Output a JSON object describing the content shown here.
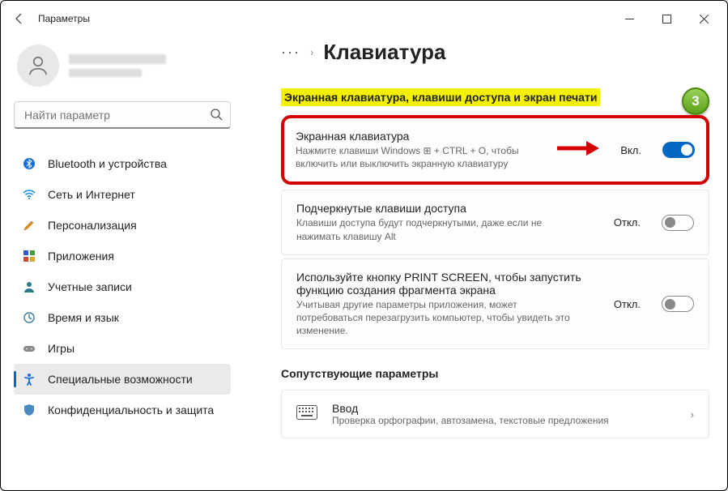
{
  "window": {
    "title": "Параметры"
  },
  "search": {
    "placeholder": "Найти параметр"
  },
  "sidebar_items": [
    {
      "label": "Bluetooth и устройства"
    },
    {
      "label": "Сеть и Интернет"
    },
    {
      "label": "Персонализация"
    },
    {
      "label": "Приложения"
    },
    {
      "label": "Учетные записи"
    },
    {
      "label": "Время и язык"
    },
    {
      "label": "Игры"
    },
    {
      "label": "Специальные возможности"
    },
    {
      "label": "Конфиденциальность и защита"
    }
  ],
  "breadcrumb": {
    "dots": "···",
    "sep": "›",
    "page": "Клавиатура"
  },
  "section_title": "Экранная клавиатура, клавиши доступа и экран печати",
  "badge": "3",
  "cards": [
    {
      "title": "Экранная клавиатура",
      "desc": "Нажмите клавиши Windows ⊞ + CTRL + O, чтобы включить или выключить экранную клавиатуру",
      "state_label": "Вкл.",
      "on": true
    },
    {
      "title": "Подчеркнутые клавиши доступа",
      "desc": "Клавиши доступа будут подчеркнутыми, даже если не нажимать клавишу Alt",
      "state_label": "Откл.",
      "on": false
    },
    {
      "title": "Используйте кнопку PRINT SCREEN, чтобы запустить функцию создания фрагмента экрана",
      "desc": "Учитывая другие параметры приложения, может потребоваться перезагрузить компьютер, чтобы увидеть это изменение.",
      "state_label": "Откл.",
      "on": false
    }
  ],
  "related": {
    "title": "Сопутствующие параметры",
    "item": {
      "title": "Ввод",
      "desc": "Проверка орфографии, автозамена, текстовые предложения"
    }
  }
}
